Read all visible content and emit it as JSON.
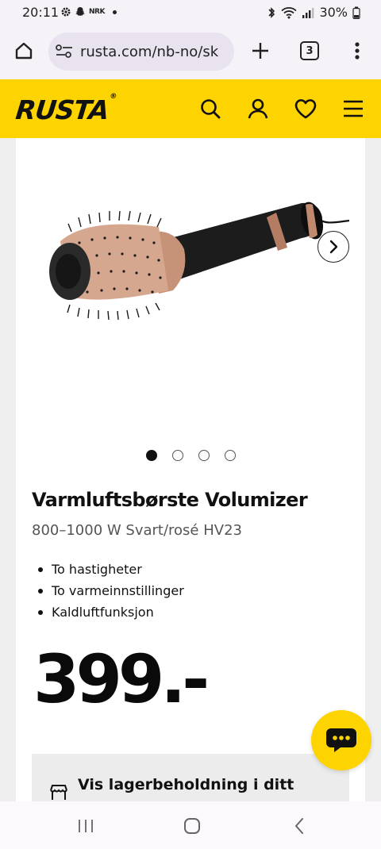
{
  "status_bar": {
    "time": "20:11",
    "notification_label": "NRK",
    "battery": "30%"
  },
  "browser": {
    "url": "rusta.com/nb-no/sk",
    "tab_count": "3"
  },
  "site": {
    "logo": "RUSTA",
    "logo_mark": "®",
    "brand_color": "#fdd300"
  },
  "product": {
    "title": "Varmluftsbørste Volumizer",
    "subtitle": "800–1000 W Svart/rosé HV23",
    "features": [
      "To hastigheter",
      "To varmeinnstillinger",
      "Kaldluftfunksjon"
    ],
    "price": "399.-",
    "carousel": {
      "image_count": 4,
      "active_index": 0
    }
  },
  "stock": {
    "label": "Vis lagerbeholdning i ditt"
  },
  "icons": {
    "home": "home-icon",
    "site_settings": "tune-icon",
    "new_tab": "plus-icon",
    "menu": "more-vert-icon",
    "search": "search-icon",
    "account": "user-icon",
    "wishlist": "heart-icon",
    "hamburger": "hamburger-icon",
    "next": "chevron-right-icon",
    "store": "store-icon",
    "chat": "chat-icon"
  }
}
